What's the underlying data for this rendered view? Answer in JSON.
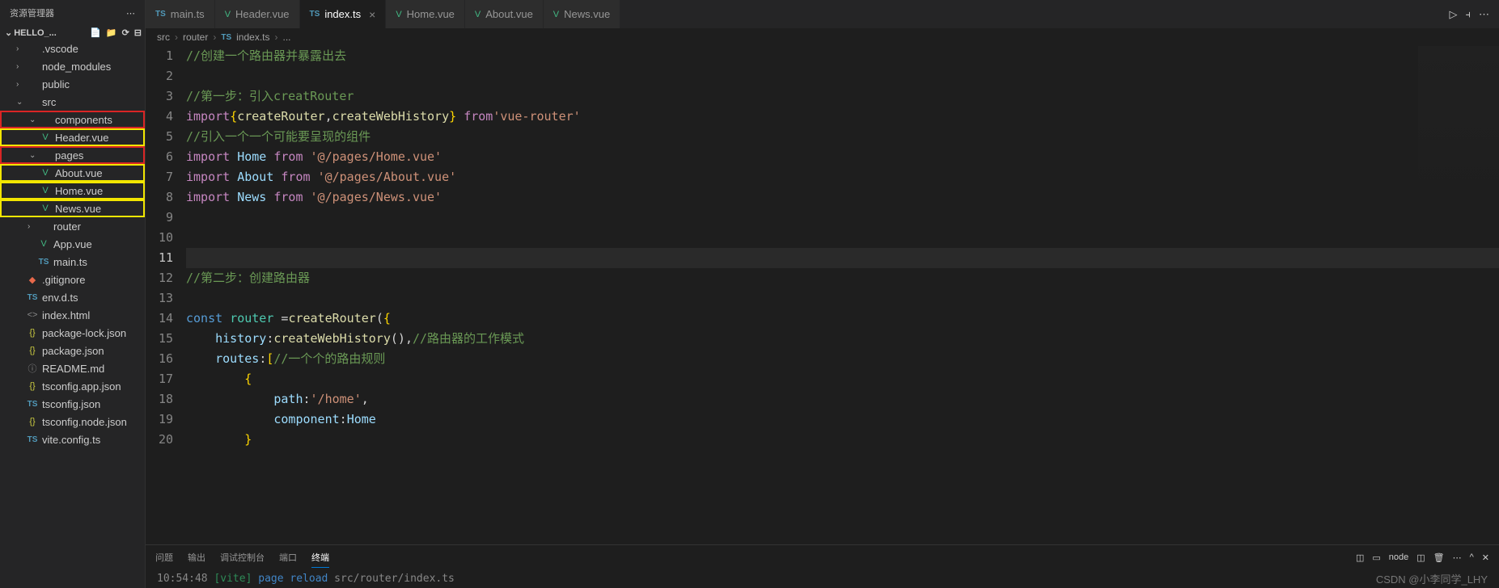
{
  "sidebar": {
    "title": "资源管理器",
    "project": "HELLO_...",
    "items": [
      {
        "chev": "›",
        "icon": "",
        "label": ".vscode",
        "cls": "indent-1"
      },
      {
        "chev": "›",
        "icon": "",
        "label": "node_modules",
        "cls": "indent-1"
      },
      {
        "chev": "›",
        "icon": "",
        "label": "public",
        "cls": "indent-1"
      },
      {
        "chev": "⌄",
        "icon": "",
        "label": "src",
        "cls": "indent-1"
      },
      {
        "chev": "⌄",
        "icon": "",
        "label": "components",
        "cls": "indent-2 box-red"
      },
      {
        "chev": "",
        "icon": "V",
        "iconCls": "icon-vue",
        "label": "Header.vue",
        "cls": "indent-2 box-yellow"
      },
      {
        "chev": "⌄",
        "icon": "",
        "label": "pages",
        "cls": "indent-2 box-red"
      },
      {
        "chev": "",
        "icon": "V",
        "iconCls": "icon-vue",
        "label": "About.vue",
        "cls": "indent-2 box-yellow"
      },
      {
        "chev": "",
        "icon": "V",
        "iconCls": "icon-vue",
        "label": "Home.vue",
        "cls": "indent-2 box-yellow"
      },
      {
        "chev": "",
        "icon": "V",
        "iconCls": "icon-vue",
        "label": "News.vue",
        "cls": "indent-2 box-yellow"
      },
      {
        "chev": "›",
        "icon": "",
        "label": "router",
        "cls": "indent-2"
      },
      {
        "chev": "",
        "icon": "V",
        "iconCls": "icon-vue",
        "label": "App.vue",
        "cls": "indent-2"
      },
      {
        "chev": "",
        "icon": "TS",
        "iconCls": "icon-ts",
        "label": "main.ts",
        "cls": "indent-2"
      },
      {
        "chev": "",
        "icon": "◆",
        "iconCls": "icon-git",
        "label": ".gitignore",
        "cls": "indent-1"
      },
      {
        "chev": "",
        "icon": "TS",
        "iconCls": "icon-ts",
        "label": "env.d.ts",
        "cls": "indent-1"
      },
      {
        "chev": "",
        "icon": "<>",
        "iconCls": "icon-file",
        "label": "index.html",
        "cls": "indent-1"
      },
      {
        "chev": "",
        "icon": "{}",
        "iconCls": "icon-json",
        "label": "package-lock.json",
        "cls": "indent-1"
      },
      {
        "chev": "",
        "icon": "{}",
        "iconCls": "icon-json",
        "label": "package.json",
        "cls": "indent-1"
      },
      {
        "chev": "",
        "icon": "ⓘ",
        "iconCls": "icon-file",
        "label": "README.md",
        "cls": "indent-1"
      },
      {
        "chev": "",
        "icon": "{}",
        "iconCls": "icon-json",
        "label": "tsconfig.app.json",
        "cls": "indent-1"
      },
      {
        "chev": "",
        "icon": "TS",
        "iconCls": "icon-ts",
        "label": "tsconfig.json",
        "cls": "indent-1"
      },
      {
        "chev": "",
        "icon": "{}",
        "iconCls": "icon-json",
        "label": "tsconfig.node.json",
        "cls": "indent-1"
      },
      {
        "chev": "",
        "icon": "TS",
        "iconCls": "icon-ts",
        "label": "vite.config.ts",
        "cls": "indent-1"
      }
    ]
  },
  "tabs": [
    {
      "icon": "TS",
      "iconCls": "icon-ts",
      "label": "main.ts"
    },
    {
      "icon": "V",
      "iconCls": "icon-vue",
      "label": "Header.vue"
    },
    {
      "icon": "TS",
      "iconCls": "icon-ts",
      "label": "index.ts",
      "active": true
    },
    {
      "icon": "V",
      "iconCls": "icon-vue",
      "label": "Home.vue"
    },
    {
      "icon": "V",
      "iconCls": "icon-vue",
      "label": "About.vue"
    },
    {
      "icon": "V",
      "iconCls": "icon-vue",
      "label": "News.vue"
    }
  ],
  "breadcrumbs": [
    "src",
    "router",
    "index.ts",
    "..."
  ],
  "code": {
    "lines": [
      {
        "n": 1,
        "html": "<span class='tk-comment'>//创建一个路由器并暴露出去</span>"
      },
      {
        "n": 2,
        "html": ""
      },
      {
        "n": 3,
        "html": "<span class='tk-comment'>//第一步：引入creatRouter</span>"
      },
      {
        "n": 4,
        "html": "<span class='tk-keyword2'>import</span><span class='tk-brace'>{</span><span class='tk-func'>createRouter</span><span class='tk-punct'>,</span><span class='tk-func'>createWebHistory</span><span class='tk-brace'>}</span> <span class='tk-keyword2'>from</span><span class='tk-str'>'vue-router'</span>"
      },
      {
        "n": 5,
        "html": "<span class='tk-comment'>//引入一个一个可能要呈现的组件</span>"
      },
      {
        "n": 6,
        "html": "<span class='tk-keyword2'>import</span> <span class='tk-var'>Home</span> <span class='tk-keyword2'>from</span> <span class='tk-str'>'@/pages/Home.vue'</span>"
      },
      {
        "n": 7,
        "html": "<span class='tk-keyword2'>import</span> <span class='tk-var'>About</span> <span class='tk-keyword2'>from</span> <span class='tk-str'>'@/pages/About.vue'</span>"
      },
      {
        "n": 8,
        "html": "<span class='tk-keyword2'>import</span> <span class='tk-var'>News</span> <span class='tk-keyword2'>from</span> <span class='tk-str'>'@/pages/News.vue'</span>"
      },
      {
        "n": 9,
        "html": ""
      },
      {
        "n": 10,
        "html": ""
      },
      {
        "n": 11,
        "html": "",
        "active": true
      },
      {
        "n": 12,
        "html": "<span class='tk-comment'>//第二步：创建路由器</span>"
      },
      {
        "n": 13,
        "html": ""
      },
      {
        "n": 14,
        "html": "<span class='tk-keyword'>const</span> <span class='tk-type'>router</span> <span class='tk-punct'>=</span><span class='tk-func'>createRouter</span><span class='tk-punct'>(</span><span class='tk-brace'>{</span>"
      },
      {
        "n": 15,
        "html": "    <span class='tk-var'>history</span><span class='tk-punct'>:</span><span class='tk-func'>createWebHistory</span><span class='tk-punct'>()</span><span class='tk-punct'>,</span><span class='tk-comment'>//路由器的工作模式</span>"
      },
      {
        "n": 16,
        "html": "    <span class='tk-var'>routes</span><span class='tk-punct'>:</span><span class='tk-brace'>[</span><span class='tk-comment'>//一个个的路由规则</span>"
      },
      {
        "n": 17,
        "html": "        <span class='tk-brace'>{</span>"
      },
      {
        "n": 18,
        "html": "            <span class='tk-var'>path</span><span class='tk-punct'>:</span><span class='tk-str'>'/home'</span><span class='tk-punct'>,</span>"
      },
      {
        "n": 19,
        "html": "            <span class='tk-var'>component</span><span class='tk-punct'>:</span><span class='tk-var'>Home</span>"
      },
      {
        "n": 20,
        "html": "        <span class='tk-brace'>}</span>"
      }
    ]
  },
  "panel": {
    "tabs": [
      "问题",
      "输出",
      "调试控制台",
      "端口",
      "终端"
    ],
    "active": 4,
    "right_label": "node",
    "terminal": {
      "time": "10:54:48",
      "tag": "[vite]",
      "msg": "page reload",
      "path": "src/router/index.ts"
    }
  },
  "watermark": "CSDN @小李同学_LHY"
}
